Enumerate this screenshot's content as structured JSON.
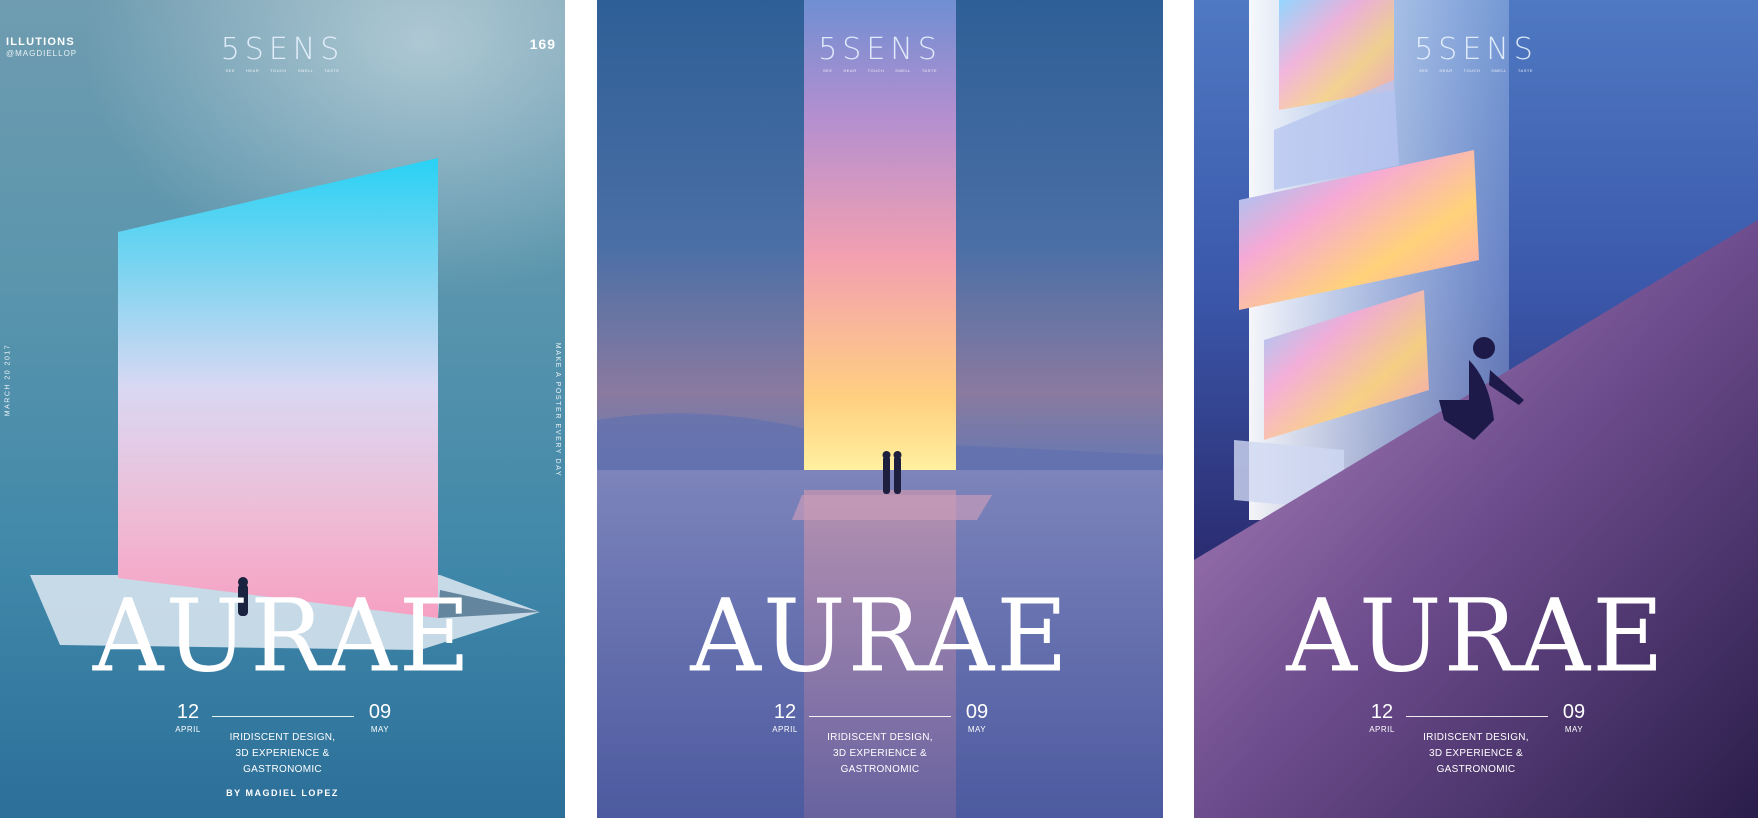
{
  "posters": [
    {
      "brand": {
        "logo": "5SENS",
        "senses": [
          "SEE",
          "HEAR",
          "TOUCH",
          "SMELL",
          "TASTE"
        ]
      },
      "top_left": {
        "title": "ILLUTIONS",
        "handle": "@MAGDIELLOP"
      },
      "top_right": "169",
      "side_left": "MARCH 20 2017",
      "side_right": "MAKE A POSTER EVERY DAY",
      "title": "AURAE",
      "start": {
        "day": "12",
        "month": "APRIL"
      },
      "end": {
        "day": "09",
        "month": "MAY"
      },
      "description": [
        "IRIDISCENT DESIGN,",
        "3D EXPERIENCE &",
        "GASTRONOMIC"
      ],
      "byline": "BY MAGDIEL LOPEZ"
    },
    {
      "brand": {
        "logo": "5SENS",
        "senses": [
          "SEE",
          "HEAR",
          "TOUCH",
          "SMELL",
          "TASTE"
        ]
      },
      "title": "AURAE",
      "start": {
        "day": "12",
        "month": "APRIL"
      },
      "end": {
        "day": "09",
        "month": "MAY"
      },
      "description": [
        "IRIDISCENT DESIGN,",
        "3D EXPERIENCE &",
        "GASTRONOMIC"
      ]
    },
    {
      "brand": {
        "logo": "5SENS",
        "senses": [
          "SEE",
          "HEAR",
          "TOUCH",
          "SMELL",
          "TASTE"
        ]
      },
      "title": "AURAE",
      "start": {
        "day": "12",
        "month": "APRIL"
      },
      "end": {
        "day": "09",
        "month": "MAY"
      },
      "description": [
        "IRIDISCENT DESIGN,",
        "3D EXPERIENCE &",
        "GASTRONOMIC"
      ]
    }
  ]
}
